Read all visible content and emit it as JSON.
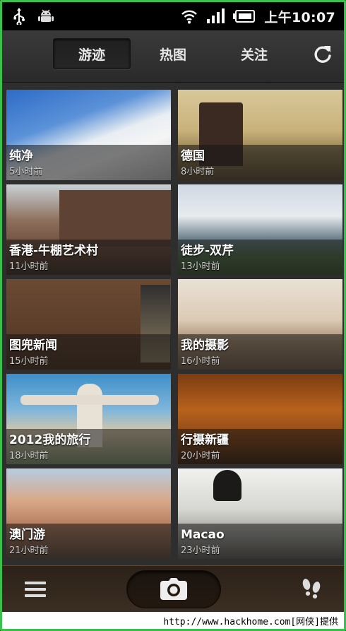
{
  "status_bar": {
    "time": "上午10:07",
    "icons": [
      "usb-icon",
      "android-debug-icon",
      "wifi-icon",
      "signal-icon",
      "battery-icon"
    ]
  },
  "tabs": [
    {
      "label": "游迹",
      "active": true
    },
    {
      "label": "热图",
      "active": false
    },
    {
      "label": "关注",
      "active": false
    }
  ],
  "toolbar": {
    "refresh_icon": "refresh-icon"
  },
  "tiles": [
    {
      "title": "纯净",
      "time": "5小时前"
    },
    {
      "title": "德国",
      "time": "8小时前"
    },
    {
      "title": "香港-牛棚艺术村",
      "time": "11小时前"
    },
    {
      "title": "徒步-双芹",
      "time": "13小时前"
    },
    {
      "title": "图兜新闻",
      "time": "15小时前"
    },
    {
      "title": "我的摄影",
      "time": "16小时前"
    },
    {
      "title": "2012我的旅行",
      "time": "18小时前"
    },
    {
      "title": "行摄新疆",
      "time": "20小时前"
    },
    {
      "title": "澳门游",
      "time": "21小时前"
    },
    {
      "title": "Macao",
      "time": "23小时前"
    }
  ],
  "bottom_bar": {
    "menu_icon": "menu-icon",
    "camera_icon": "camera-icon",
    "footprints_icon": "footprints-icon"
  },
  "watermark": "http://www.hackhome.com[网侠]提供",
  "colors": {
    "frame": "#39c24b",
    "top_bar": "#2e2e2e",
    "bottom_bar": "#3b2e22"
  }
}
